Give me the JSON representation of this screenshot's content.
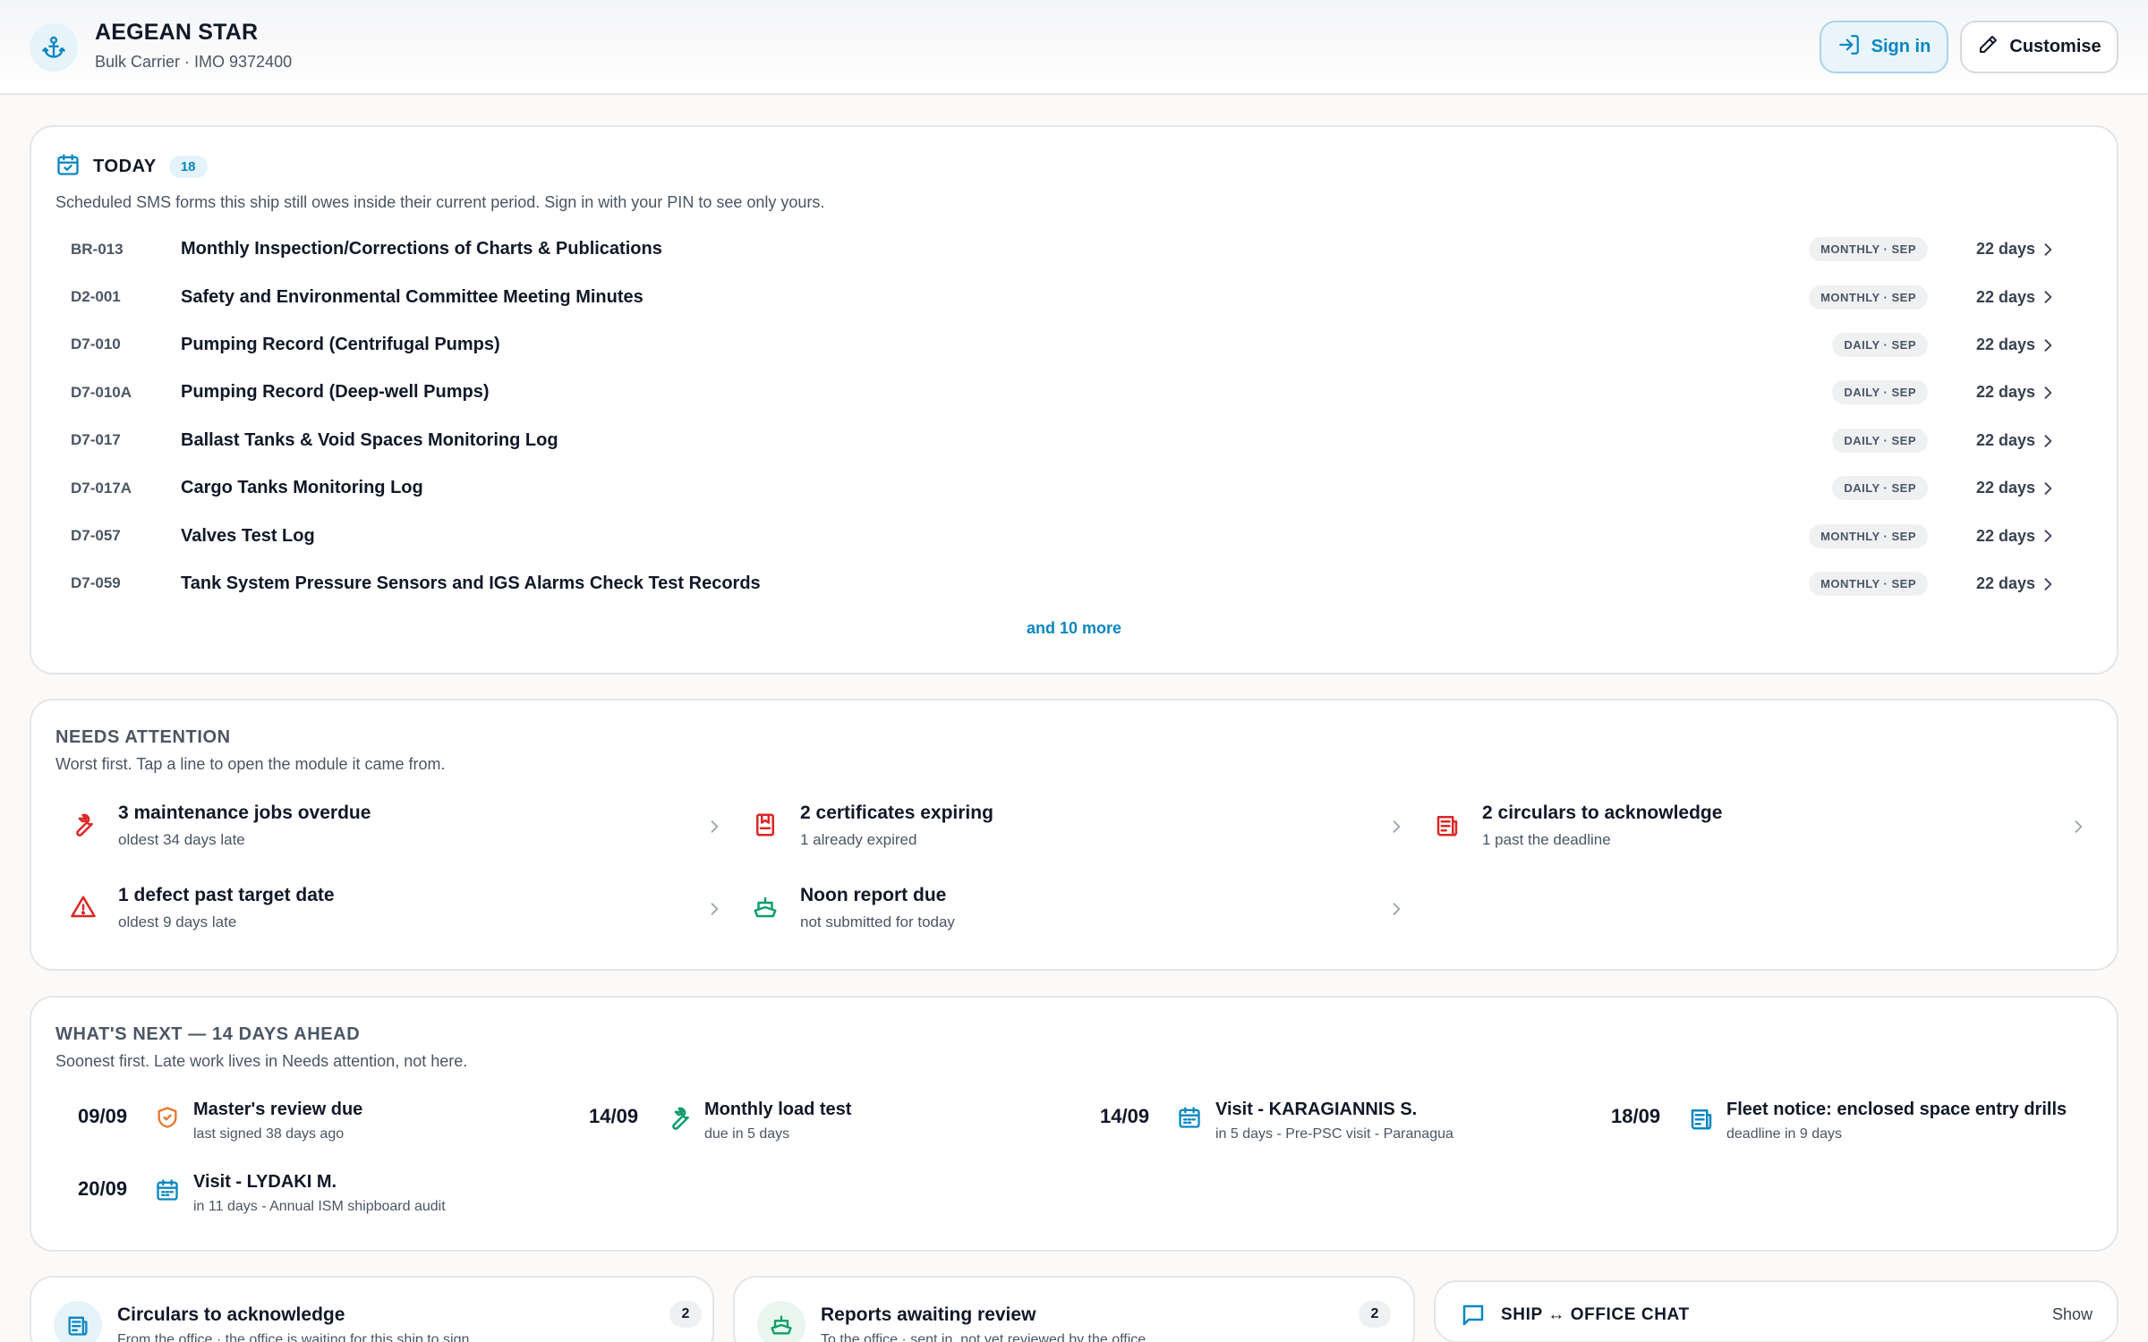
{
  "ship": {
    "name": "AEGEAN STAR",
    "subtitle": "Bulk Carrier · IMO 9372400"
  },
  "header": {
    "signin_label": "Sign in",
    "customise_label": "Customise",
    "accent_color": "#0a86c2"
  },
  "today": {
    "title": "TODAY",
    "count": "18",
    "description": "Scheduled SMS forms this ship still owes inside their current period. Sign in with your PIN to see only yours.",
    "tasks": [
      {
        "code": "BR-013",
        "title": "Monthly Inspection/Corrections of Charts & Publications",
        "badge": "MONTHLY · SEP",
        "days": "22 days"
      },
      {
        "code": "D2-001",
        "title": "Safety and Environmental Committee Meeting Minutes",
        "badge": "MONTHLY · SEP",
        "days": "22 days"
      },
      {
        "code": "D7-010",
        "title": "Pumping Record (Centrifugal Pumps)",
        "badge": "DAILY · SEP",
        "days": "22 days"
      },
      {
        "code": "D7-010A",
        "title": "Pumping Record (Deep-well Pumps)",
        "badge": "DAILY · SEP",
        "days": "22 days"
      },
      {
        "code": "D7-017",
        "title": "Ballast Tanks & Void Spaces Monitoring Log",
        "badge": "DAILY · SEP",
        "days": "22 days"
      },
      {
        "code": "D7-017A",
        "title": "Cargo Tanks Monitoring Log",
        "badge": "DAILY · SEP",
        "days": "22 days"
      },
      {
        "code": "D7-057",
        "title": "Valves Test Log",
        "badge": "MONTHLY · SEP",
        "days": "22 days"
      },
      {
        "code": "D7-059",
        "title": "Tank System Pressure Sensors and IGS Alarms Check Test Records",
        "badge": "MONTHLY · SEP",
        "days": "22 days"
      }
    ],
    "more_label": "and 10 more"
  },
  "attention": {
    "title": "NEEDS ATTENTION",
    "description": "Worst first. Tap a line to open the module it came from.",
    "items": [
      {
        "icon": "wrench-icon",
        "title": "3 maintenance jobs overdue",
        "sub": "oldest 34 days late",
        "color": "#dc2626"
      },
      {
        "icon": "certificate-icon",
        "title": "2 certificates expiring",
        "sub": "1 already expired",
        "color": "#dc2626"
      },
      {
        "icon": "newspaper-icon",
        "title": "2 circulars to acknowledge",
        "sub": "1 past the deadline",
        "color": "#dc2626"
      },
      {
        "icon": "warning-icon",
        "title": "1 defect past target date",
        "sub": "oldest 9 days late",
        "color": "#dc2626"
      },
      {
        "icon": "ship-icon",
        "title": "Noon report due",
        "sub": "not submitted for today",
        "color": "#0f9d6b"
      }
    ]
  },
  "next": {
    "title": "WHAT'S NEXT — 14 DAYS AHEAD",
    "description": "Soonest first. Late work lives in Needs attention, not here.",
    "items": [
      {
        "date": "09/09",
        "icon": "shield-check-icon",
        "title": "Master's review due",
        "sub": "last signed 38 days ago",
        "color": "#e8772e"
      },
      {
        "date": "14/09",
        "icon": "wrench-icon",
        "title": "Monthly load test",
        "sub": "due in 5 days",
        "color": "#0f9d6b"
      },
      {
        "date": "14/09",
        "icon": "calendar-icon",
        "title": "Visit - KARAGIANNIS S.",
        "sub": "in 5 days - Pre-PSC visit - Paranagua",
        "color": "#0a86c2"
      },
      {
        "date": "18/09",
        "icon": "newspaper-icon",
        "title": "Fleet notice: enclosed space entry drills",
        "sub": "deadline in 9 days",
        "color": "#0a86c2"
      },
      {
        "date": "20/09",
        "icon": "calendar-icon",
        "title": "Visit - LYDAKI M.",
        "sub": "in 11 days - Annual ISM shipboard audit",
        "color": "#0a86c2"
      }
    ]
  },
  "bottom": {
    "circulars": {
      "title": "Circulars to acknowledge",
      "sub": "From the office · the office is waiting for this ship to sign",
      "count": "2"
    },
    "reports": {
      "title": "Reports awaiting review",
      "sub": "To the office · sent in, not yet reviewed by the office",
      "count": "2"
    },
    "chat": {
      "title": "SHIP ↔ OFFICE CHAT",
      "show_label": "Show"
    }
  }
}
